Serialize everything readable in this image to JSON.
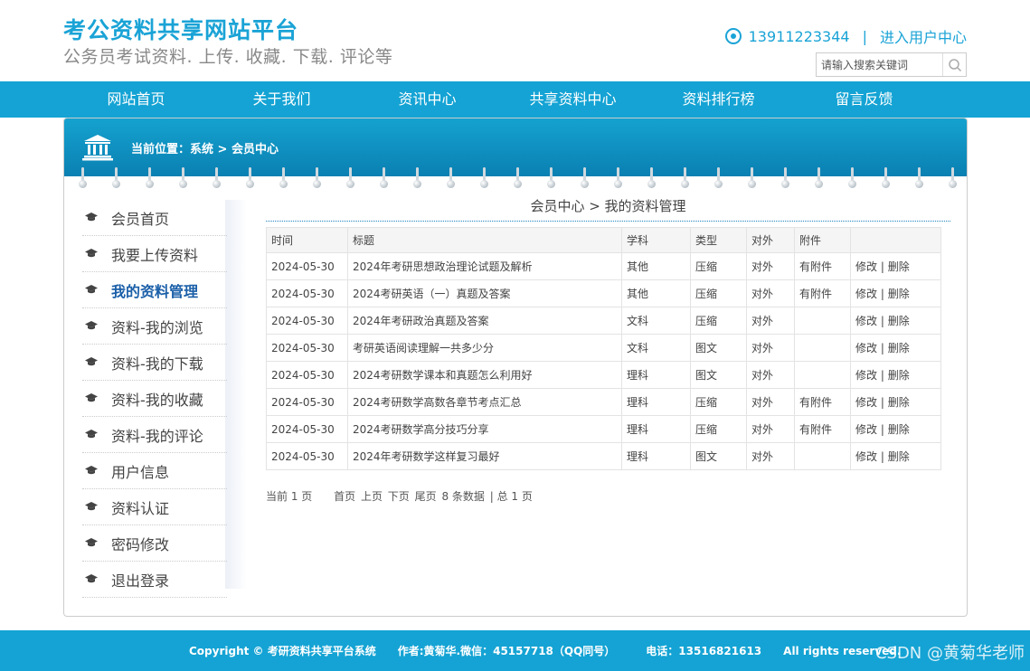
{
  "header": {
    "title": "考公资料共享网站平台",
    "subtitle": "公务员考试资料. 上传. 收藏. 下载. 评论等",
    "phone": "13911223344",
    "separator": "|",
    "user_center": "进入用户中心",
    "search_placeholder": "请输入搜索关键词"
  },
  "nav": [
    "网站首页",
    "关于我们",
    "资讯中心",
    "共享资料中心",
    "资料排行榜",
    "留言反馈"
  ],
  "banner": {
    "crumb": "当前位置：系统 > 会员中心"
  },
  "sidebar": [
    {
      "label": "会员首页",
      "active": false
    },
    {
      "label": "我要上传资料",
      "active": false
    },
    {
      "label": "我的资料管理",
      "active": true
    },
    {
      "label": "资料-我的浏览",
      "active": false
    },
    {
      "label": "资料-我的下载",
      "active": false
    },
    {
      "label": "资料-我的收藏",
      "active": false
    },
    {
      "label": "资料-我的评论",
      "active": false
    },
    {
      "label": "用户信息",
      "active": false
    },
    {
      "label": "资料认证",
      "active": false
    },
    {
      "label": "密码修改",
      "active": false
    },
    {
      "label": "退出登录",
      "active": false
    }
  ],
  "content": {
    "title": "会员中心 > 我的资料管理",
    "columns": [
      "时间",
      "标题",
      "学科",
      "类型",
      "对外",
      "附件",
      ""
    ],
    "rows": [
      [
        "2024-05-30",
        "2024年考研思想政治理论试题及解析",
        "其他",
        "压缩",
        "对外",
        "有附件"
      ],
      [
        "2024-05-30",
        "2024考研英语（一）真题及答案",
        "其他",
        "压缩",
        "对外",
        "有附件"
      ],
      [
        "2024-05-30",
        "2024年考研政治真题及答案",
        "文科",
        "压缩",
        "对外",
        ""
      ],
      [
        "2024-05-30",
        "考研英语阅读理解一共多少分",
        "文科",
        "图文",
        "对外",
        ""
      ],
      [
        "2024-05-30",
        "2024考研数学课本和真题怎么利用好",
        "理科",
        "图文",
        "对外",
        ""
      ],
      [
        "2024-05-30",
        "2024考研数学高数各章节考点汇总",
        "理科",
        "压缩",
        "对外",
        "有附件"
      ],
      [
        "2024-05-30",
        "2024考研数学高分技巧分享",
        "理科",
        "压缩",
        "对外",
        "有附件"
      ],
      [
        "2024-05-30",
        "2024年考研数学这样复习最好",
        "理科",
        "图文",
        "对外",
        ""
      ]
    ],
    "action_edit": "修改",
    "action_sep": "|",
    "action_delete": "删除",
    "pager": {
      "current": "当前 1 页",
      "first": "首页",
      "prev": "上页",
      "next": "下页",
      "last": "尾页",
      "count": "8 条数据",
      "total": "| 总 1 页"
    }
  },
  "footer": {
    "copyright": "Copyright © 考研资料共享平台系统",
    "author": "作者:黄菊华.微信：45157718（QQ同号）",
    "phone": "电话：13516821613",
    "rights": "All rights reserved.",
    "watermark": "CSDN @黄菊华老师"
  },
  "colors": {
    "accent": "#14a3d4",
    "active": "#1a5fa8"
  }
}
